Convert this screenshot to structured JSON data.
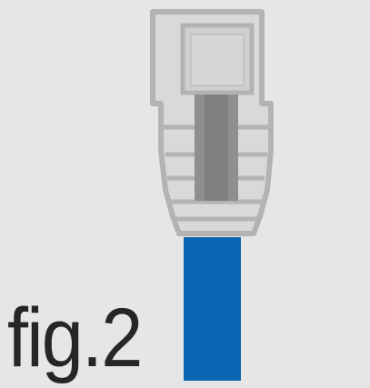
{
  "figure": {
    "label": "fig.2",
    "subject_icon": "rj45-connector-icon",
    "colors": {
      "background": "#e6e6e6",
      "outline": "#b3b3b3",
      "body_fill": "#d9d9d9",
      "latch_fill": "#c9c9c9",
      "core_fill": "#8f8f8f",
      "cable_blue": "#0a67b4",
      "label_text": "#262626"
    }
  }
}
